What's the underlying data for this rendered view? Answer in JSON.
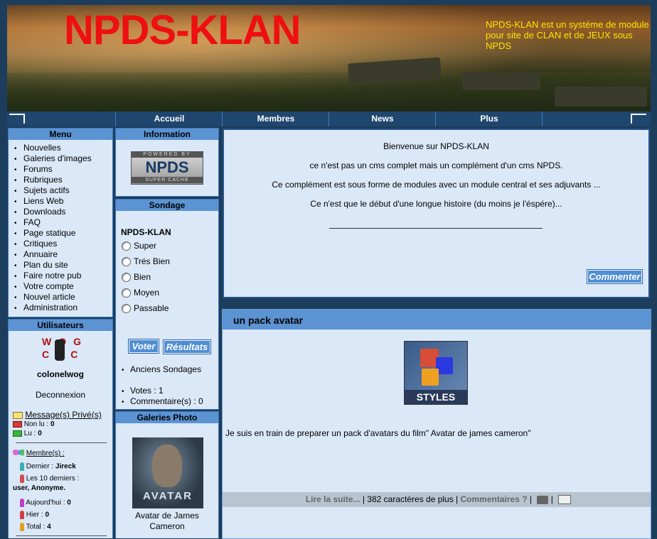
{
  "banner": {
    "title": "NPDS-KLAN",
    "tagline": "NPDS-KLAN est un systéme de module pour site de CLAN et de JEUX sous NPDS"
  },
  "nav": [
    "Accueil",
    "Membres",
    "News",
    "Plus"
  ],
  "menu": {
    "title": "Menu",
    "items": [
      "Nouvelles",
      "Galeries d'images",
      "Forums",
      "Rubriques",
      "Sujets actifs",
      "Liens Web",
      "Downloads",
      "FAQ",
      "Page statique",
      "Critiques",
      "Annuaire",
      "Plan du site",
      "Faire notre pub",
      "Votre compte",
      "Nouvel article",
      "Administration"
    ]
  },
  "users": {
    "title": "Utilisateurs",
    "avatar_text": "WOG CNC",
    "username": "colonelwog",
    "logout": "Deconnexion",
    "pm_link": "Message(s) Privé(s)",
    "unread_label": "Non lu :",
    "unread": "0",
    "read_label": "Lu :",
    "read": "0",
    "members_link": "Membre(s) :",
    "last_label": "Dernier :",
    "last": "Jireck",
    "last10_label": "Les 10 derniers :",
    "last10": "user, Anonyme.",
    "today_label": "Aujourd'hui :",
    "today": "0",
    "yesterday_label": "Hier :",
    "yesterday": "0",
    "total_label": "Total :",
    "total": "4"
  },
  "info": {
    "title": "Information",
    "logo_top": "POWERED BY",
    "logo_main": "NPDS",
    "logo_bottom": "SUPER CACHE"
  },
  "poll": {
    "title": "Sondage",
    "question": "NPDS-KLAN",
    "options": [
      "Super",
      "Trés Bien",
      "Bien",
      "Moyen",
      "Passable"
    ],
    "vote_btn": "Voter",
    "results_btn": "Résultats",
    "old_polls": "Anciens Sondages",
    "votes_label": "Votes :",
    "votes": "1",
    "comments_label": "Commentaire(s) :",
    "comments": "0"
  },
  "gallery": {
    "title": "Galeries Photo",
    "image_text": "AVATAR",
    "caption": "Avatar de James Cameron"
  },
  "welcome": {
    "lines": [
      "Bienvenue sur NPDS-KLAN",
      "ce n'est pas un cms complet mais un complément d'un cms NPDS.",
      "Ce complément est sous forme de modules avec un module central et ses adjuvants ...",
      "Ce n'est que le début d'une longue histoire (du moins je l'éspére)..."
    ],
    "comment_btn": "Commenter"
  },
  "article": {
    "title": "un pack avatar",
    "image_text": "STYLES",
    "body": "Je suis en train de preparer un pack d'avatars du film\" Avatar de james cameron\"",
    "read_more": "Lire la suite...",
    "chars": "| 382 caractères de plus |",
    "comments": "Commentaires ?",
    "sep": "|"
  }
}
